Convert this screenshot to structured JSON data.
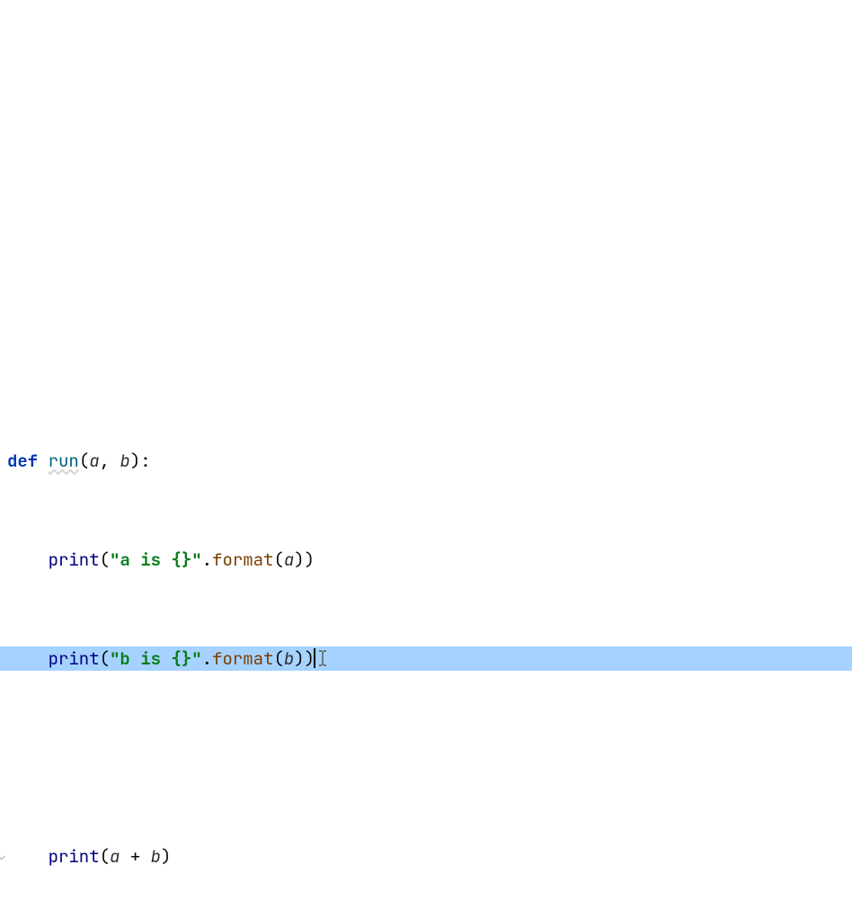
{
  "code": {
    "line1": {
      "kw": "def ",
      "fname": "run",
      "open": "(",
      "p1": "a",
      "c1": ", ",
      "p2": "b",
      "close": "):"
    },
    "line2": {
      "indent": "    ",
      "fn": "print",
      "open": "(",
      "str": "\"a is {}\"",
      "dot": ".",
      "meth": "format",
      "open2": "(",
      "arg": "a",
      "close": "))"
    },
    "line3": {
      "indent": "    ",
      "fn": "print",
      "open": "(",
      "str": "\"b is {}\"",
      "dot": ".",
      "meth": "format",
      "open2": "(",
      "arg": "b",
      "close": "))"
    },
    "line5": {
      "indent": "    ",
      "fn": "print",
      "open": "(",
      "a1": "a",
      "op": " + ",
      "a2": "b",
      "close": ")"
    }
  },
  "markers": {
    "fold": "⌄"
  }
}
